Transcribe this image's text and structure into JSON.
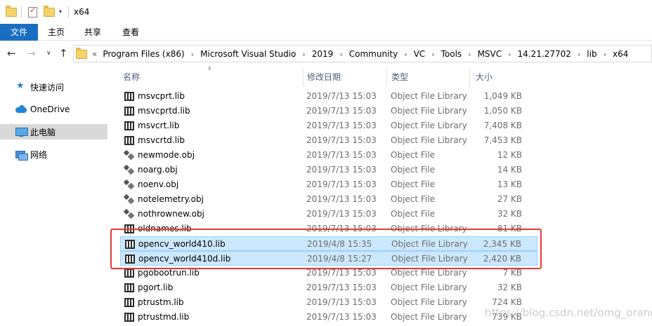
{
  "window": {
    "title": "x64"
  },
  "ribbon": {
    "tabs": [
      "文件",
      "主页",
      "共享",
      "查看"
    ]
  },
  "address": {
    "overflow": "«",
    "crumbs": [
      "Program Files (x86)",
      "Microsoft Visual Studio",
      "2019",
      "Community",
      "VC",
      "Tools",
      "MSVC",
      "14.21.27702",
      "lib",
      "x64"
    ]
  },
  "navpane": {
    "items": [
      {
        "label": "快速访问",
        "icon": "quick-access-star-icon"
      },
      {
        "label": "OneDrive",
        "icon": "onedrive-cloud-icon"
      },
      {
        "label": "此电脑",
        "icon": "this-pc-icon",
        "selected": true
      },
      {
        "label": "网络",
        "icon": "network-icon"
      }
    ]
  },
  "columns": {
    "name": "名称",
    "date": "修改日期",
    "type": "类型",
    "size": "大小"
  },
  "files": [
    {
      "name": "msvcprt.lib",
      "date": "2019/7/13 15:03",
      "type": "Object File Library",
      "size": "1,049 KB",
      "kind": "lib"
    },
    {
      "name": "msvcprtd.lib",
      "date": "2019/7/13 15:03",
      "type": "Object File Library",
      "size": "1,050 KB",
      "kind": "lib"
    },
    {
      "name": "msvcrt.lib",
      "date": "2019/7/13 15:03",
      "type": "Object File Library",
      "size": "7,408 KB",
      "kind": "lib"
    },
    {
      "name": "msvcrtd.lib",
      "date": "2019/7/13 15:03",
      "type": "Object File Library",
      "size": "7,453 KB",
      "kind": "lib"
    },
    {
      "name": "newmode.obj",
      "date": "2019/7/13 15:03",
      "type": "Object File",
      "size": "12 KB",
      "kind": "obj"
    },
    {
      "name": "noarg.obj",
      "date": "2019/7/13 15:03",
      "type": "Object File",
      "size": "14 KB",
      "kind": "obj"
    },
    {
      "name": "noenv.obj",
      "date": "2019/7/13 15:03",
      "type": "Object File",
      "size": "13 KB",
      "kind": "obj"
    },
    {
      "name": "notelemetry.obj",
      "date": "2019/7/13 15:03",
      "type": "Object File",
      "size": "27 KB",
      "kind": "obj"
    },
    {
      "name": "nothrownew.obj",
      "date": "2019/7/13 15:03",
      "type": "Object File",
      "size": "32 KB",
      "kind": "obj"
    },
    {
      "name": "oldnames.lib",
      "date": "2019/7/13 15:03",
      "type": "Object File Library",
      "size": "81 KB",
      "kind": "lib"
    },
    {
      "name": "opencv_world410.lib",
      "date": "2019/4/8 15:35",
      "type": "Object File Library",
      "size": "2,345 KB",
      "kind": "lib",
      "selected": true
    },
    {
      "name": "opencv_world410d.lib",
      "date": "2019/4/8 15:27",
      "type": "Object File Library",
      "size": "2,420 KB",
      "kind": "lib",
      "selected": true
    },
    {
      "name": "pgobootrun.lib",
      "date": "2019/7/13 15:03",
      "type": "Object File Library",
      "size": "7 KB",
      "kind": "lib"
    },
    {
      "name": "pgort.lib",
      "date": "2019/7/13 15:03",
      "type": "Object File Library",
      "size": "32 KB",
      "kind": "lib"
    },
    {
      "name": "ptrustm.lib",
      "date": "2019/7/13 15:03",
      "type": "Object File Library",
      "size": "724 KB",
      "kind": "lib"
    },
    {
      "name": "ptrustmd.lib",
      "date": "2019/7/13 15:03",
      "type": "Object File Library",
      "size": "739 KB",
      "kind": "lib"
    }
  ],
  "watermark": "https://blog.csdn.net/omg_orange",
  "colors": {
    "file_tab": "#1a6ec2",
    "selection": "#cce8ff",
    "highlight_box": "#e53935"
  }
}
